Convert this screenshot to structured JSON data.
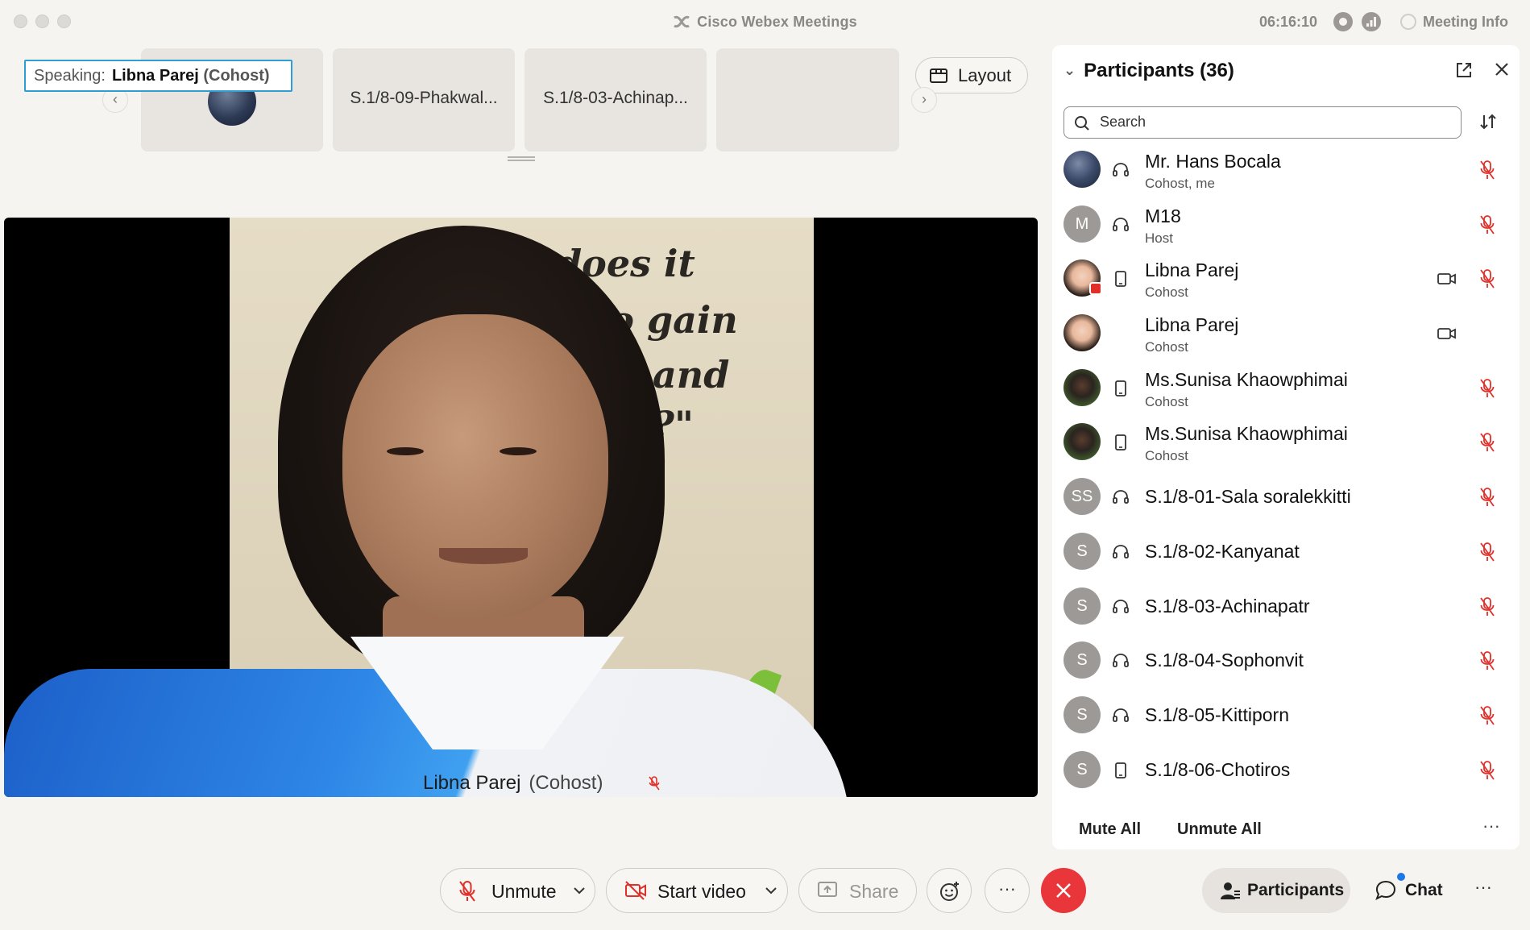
{
  "window": {
    "title": "Cisco Webex Meetings",
    "clock": "06:16:10",
    "meeting_info_label": "Meeting Info"
  },
  "stage": {
    "speaking_label": "Speaking:",
    "speaking_name": "Libna Parej",
    "speaking_role": "(Cohost)",
    "thumbnails": [
      {
        "name": "",
        "kind": "avatar"
      },
      {
        "name": "S.1/8-09-Phakwal..."
      },
      {
        "name": "S.1/8-03-Achinap..."
      },
      {
        "name": ""
      }
    ],
    "layout_label": "Layout",
    "video_name": "Libna Parej",
    "video_role": "(Cohost)",
    "video_quote_lines": [
      "does it",
      "to gain",
      "and",
      "?\""
    ]
  },
  "participants": {
    "title": "Participants (36)",
    "search_placeholder": "Search",
    "list": [
      {
        "name": "Mr. Hans Bocala",
        "role": "Cohost, me",
        "avatar": "",
        "avatar_style": "photo1",
        "device": "headset-icon",
        "video": false,
        "mic": "muted"
      },
      {
        "name": "M18",
        "role": "Host",
        "avatar": "M",
        "avatar_style": "initial",
        "device": "headset-icon",
        "video": false,
        "mic": "muted"
      },
      {
        "name": "Libna Parej",
        "role": "Cohost",
        "avatar": "",
        "avatar_style": "photo2",
        "device": "mobile-icon",
        "video": true,
        "mic": "muted",
        "sharing_badge": true
      },
      {
        "name": "Libna Parej",
        "role": "Cohost",
        "avatar": "",
        "avatar_style": "photo2",
        "device": "",
        "video": true,
        "mic": "none"
      },
      {
        "name": "Ms.Sunisa Khaowphimai",
        "role": "Cohost",
        "avatar": "",
        "avatar_style": "photo3",
        "device": "mobile-icon",
        "video": false,
        "mic": "muted"
      },
      {
        "name": "Ms.Sunisa Khaowphimai",
        "role": "Cohost",
        "avatar": "",
        "avatar_style": "photo3",
        "device": "mobile-icon",
        "video": false,
        "mic": "muted"
      },
      {
        "name": "S.1/8-01-Sala soralekkitti",
        "role": "",
        "avatar": "SS",
        "avatar_style": "initial",
        "device": "headset-icon",
        "video": false,
        "mic": "muted"
      },
      {
        "name": "S.1/8-02-Kanyanat",
        "role": "",
        "avatar": "S",
        "avatar_style": "initial",
        "device": "headset-icon",
        "video": false,
        "mic": "muted"
      },
      {
        "name": "S.1/8-03-Achinapatr",
        "role": "",
        "avatar": "S",
        "avatar_style": "initial",
        "device": "headset-icon",
        "video": false,
        "mic": "muted"
      },
      {
        "name": "S.1/8-04-Sophonvit",
        "role": "",
        "avatar": "S",
        "avatar_style": "initial",
        "device": "headset-icon",
        "video": false,
        "mic": "muted"
      },
      {
        "name": "S.1/8-05-Kittiporn",
        "role": "",
        "avatar": "S",
        "avatar_style": "initial",
        "device": "headset-icon",
        "video": false,
        "mic": "muted"
      },
      {
        "name": "S.1/8-06-Chotiros",
        "role": "",
        "avatar": "S",
        "avatar_style": "initial",
        "device": "mobile-icon",
        "video": false,
        "mic": "muted"
      }
    ],
    "mute_all": "Mute All",
    "unmute_all": "Unmute All"
  },
  "toolbar": {
    "unmute": "Unmute",
    "start_video": "Start video",
    "share": "Share",
    "participants": "Participants",
    "chat": "Chat"
  },
  "colors": {
    "accent": "#2f9fd3",
    "end_call": "#e8363a",
    "muted_mic": "#e0302a",
    "chat_dot": "#1d77e6"
  }
}
